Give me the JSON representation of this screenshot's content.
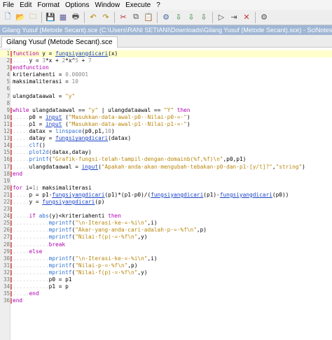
{
  "menu": [
    "File",
    "Edit",
    "Format",
    "Options",
    "Window",
    "Execute",
    "?"
  ],
  "toolbar": [
    {
      "name": "new-file-icon",
      "glyph": "🗋",
      "color": "#4a72b5"
    },
    {
      "name": "open-file-icon",
      "glyph": "📂",
      "color": "#c89b2c"
    },
    {
      "name": "open-recent-icon",
      "glyph": "🗀",
      "color": "#c89b2c"
    },
    {
      "sep": true
    },
    {
      "name": "save-icon",
      "glyph": "💾",
      "color": "#3a5fa8"
    },
    {
      "name": "save-as-icon",
      "glyph": "▦",
      "color": "#5a5a9a"
    },
    {
      "name": "print-icon",
      "glyph": "🖶",
      "color": "#555555"
    },
    {
      "sep": true
    },
    {
      "name": "undo-icon",
      "glyph": "↶",
      "color": "#b8860b"
    },
    {
      "name": "redo-icon",
      "glyph": "↷",
      "color": "#b8860b"
    },
    {
      "sep": true
    },
    {
      "name": "cut-icon",
      "glyph": "✂",
      "color": "#c03030"
    },
    {
      "name": "copy-icon",
      "glyph": "⧉",
      "color": "#505050"
    },
    {
      "name": "paste-icon",
      "glyph": "📋",
      "color": "#8a6a30"
    },
    {
      "sep": true
    },
    {
      "name": "find-replace-icon",
      "glyph": "⚙",
      "color": "#4a6aa0"
    },
    {
      "name": "load-into-scilab-icon",
      "glyph": "⇩",
      "color": "#2e8b2e"
    },
    {
      "name": "execute-file-icon",
      "glyph": "⇩",
      "color": "#2e8b2e"
    },
    {
      "name": "execute-with-echo-icon",
      "glyph": "⇩",
      "color": "#3a7a3a"
    },
    {
      "sep": true
    },
    {
      "name": "run-icon",
      "glyph": "▷",
      "color": "#505050"
    },
    {
      "name": "step-icon",
      "glyph": "⇥",
      "color": "#505050"
    },
    {
      "name": "stop-icon",
      "glyph": "✕",
      "color": "#c03030"
    },
    {
      "sep": true
    },
    {
      "name": "help-icon",
      "glyph": "⚙",
      "color": "#505050"
    }
  ],
  "window_title": "Gilang Yusuf (Metode Secant).sce (C:\\Users\\RANI SETIANI\\Downloads\\Gilang Yusuf (Metode Secant).sce) - SciNotes",
  "tab_label": "Gilang Yusuf (Metode Secant).sce",
  "code_lines": [
    [
      [
        "kw",
        "function"
      ],
      [
        "t",
        " y = "
      ],
      [
        "fn",
        "fungsiyangdicari"
      ],
      [
        "t",
        "(x)"
      ]
    ],
    [
      [
        "d",
        "....."
      ],
      [
        "t",
        "y = "
      ],
      [
        "num",
        "3"
      ],
      [
        "t",
        "*x + "
      ],
      [
        "num",
        "2"
      ],
      [
        "t",
        "*x^"
      ],
      [
        "num",
        "5"
      ],
      [
        "t",
        " + "
      ],
      [
        "num",
        "7"
      ]
    ],
    [
      [
        "kw",
        "endfunction"
      ]
    ],
    [
      [
        "t",
        "kriteriahenti = "
      ],
      [
        "num",
        "0.00001"
      ]
    ],
    [
      [
        "t",
        "maksimaliterasi = "
      ],
      [
        "num",
        "10"
      ]
    ],
    [
      [
        "t",
        ""
      ]
    ],
    [
      [
        "t",
        "ulangdataawal = "
      ],
      [
        "str",
        "\"y\""
      ]
    ],
    [
      [
        "t",
        ""
      ]
    ],
    [
      [
        "kw",
        "while"
      ],
      [
        "t",
        " ulangdataawal == "
      ],
      [
        "str",
        "\"y\""
      ],
      [
        "t",
        " | ulangdataawal == "
      ],
      [
        "str",
        "\"Y\""
      ],
      [
        "t",
        " "
      ],
      [
        "kw",
        "then"
      ]
    ],
    [
      [
        "d",
        "....."
      ],
      [
        "t",
        "p0 = "
      ],
      [
        "fn",
        "input"
      ],
      [
        "t",
        " ("
      ],
      [
        "str",
        "\"Masukkan·data·awal·p0··Nilai·p0·=·\""
      ],
      [
        "t",
        ")"
      ]
    ],
    [
      [
        "d",
        "....."
      ],
      [
        "t",
        "p1 = "
      ],
      [
        "fn",
        "input"
      ],
      [
        "t",
        " ("
      ],
      [
        "str",
        "\"Masukkan·data·awal·p1··Nilai·p1·=·\""
      ],
      [
        "t",
        ")"
      ]
    ],
    [
      [
        "d",
        "....."
      ],
      [
        "t",
        "datax = "
      ],
      [
        "bi",
        "linspace"
      ],
      [
        "t",
        "(p0,p1,"
      ],
      [
        "num",
        "10"
      ],
      [
        "t",
        ")"
      ]
    ],
    [
      [
        "d",
        "....."
      ],
      [
        "t",
        "datay = "
      ],
      [
        "fn",
        "fungsiyangdicari"
      ],
      [
        "t",
        "(datax)"
      ]
    ],
    [
      [
        "d",
        "....."
      ],
      [
        "bi",
        "clf"
      ],
      [
        "t",
        "()"
      ]
    ],
    [
      [
        "d",
        "....."
      ],
      [
        "bi",
        "plot2d"
      ],
      [
        "t",
        "(datax,datay)"
      ]
    ],
    [
      [
        "d",
        "....."
      ],
      [
        "bi",
        "printf"
      ],
      [
        "t",
        "("
      ],
      [
        "str",
        "\"Grafik·fungsi·telah·tampil·dengan·domainb(%f,%f)\\n\""
      ],
      [
        "t",
        ",p0,p1)"
      ]
    ],
    [
      [
        "d",
        "....."
      ],
      [
        "t",
        "ulangdataawal = "
      ],
      [
        "fn",
        "input"
      ],
      [
        "t",
        "("
      ],
      [
        "str",
        "\"Apakah·anda·akan·mengubah·tebakan·p0·dan·p1·[y/t]?\""
      ],
      [
        "t",
        ","
      ],
      [
        "str",
        "\"string\""
      ],
      [
        "t",
        ")"
      ]
    ],
    [
      [
        "kw",
        "end"
      ]
    ],
    [
      [
        "t",
        ""
      ]
    ],
    [
      [
        "kw",
        "for"
      ],
      [
        "t",
        " i="
      ],
      [
        "num",
        "1"
      ],
      [
        "t",
        ": maksimaliterasi"
      ]
    ],
    [
      [
        "d",
        "....."
      ],
      [
        "t",
        "p = p1-"
      ],
      [
        "fn",
        "fungsiyangdicari"
      ],
      [
        "t",
        "(p1)*(p1-p0)/("
      ],
      [
        "fn",
        "fungsiyangdicari"
      ],
      [
        "t",
        "(p1)-"
      ],
      [
        "fn",
        "fungsiyangdicari"
      ],
      [
        "t",
        "(p0))"
      ]
    ],
    [
      [
        "d",
        "....."
      ],
      [
        "t",
        "y = "
      ],
      [
        "fn",
        "fungsiyangdicari"
      ],
      [
        "t",
        "(p)"
      ]
    ],
    [
      [
        "t",
        ""
      ]
    ],
    [
      [
        "d",
        "....."
      ],
      [
        "kw",
        "if"
      ],
      [
        "t",
        " "
      ],
      [
        "bi",
        "abs"
      ],
      [
        "t",
        "(y)<kriteriahenti "
      ],
      [
        "kw",
        "then"
      ]
    ],
    [
      [
        "d",
        "..........."
      ],
      [
        "bi",
        "mprintf"
      ],
      [
        "t",
        "("
      ],
      [
        "str",
        "\"\\n·Iterasi·ke·=·%i\\n\""
      ],
      [
        "t",
        ",i)"
      ]
    ],
    [
      [
        "d",
        "..........."
      ],
      [
        "bi",
        "mprintf"
      ],
      [
        "t",
        "("
      ],
      [
        "str",
        "\"Akar·yang·anda·cari·adalah·p·=·%f\\n\""
      ],
      [
        "t",
        ",p)"
      ]
    ],
    [
      [
        "d",
        "..........."
      ],
      [
        "bi",
        "mprintf"
      ],
      [
        "t",
        "("
      ],
      [
        "str",
        "\"Nilai·f(p)·=·%f\\n\""
      ],
      [
        "t",
        ",y)"
      ]
    ],
    [
      [
        "d",
        "..........."
      ],
      [
        "kw",
        "break"
      ]
    ],
    [
      [
        "d",
        "....."
      ],
      [
        "kw",
        "else"
      ]
    ],
    [
      [
        "d",
        "..........."
      ],
      [
        "bi",
        "mprintf"
      ],
      [
        "t",
        "("
      ],
      [
        "str",
        "\"\\n·Iterasi·ke·=·%i\\n\""
      ],
      [
        "t",
        ",i)"
      ]
    ],
    [
      [
        "d",
        "..........."
      ],
      [
        "bi",
        "mprintf"
      ],
      [
        "t",
        "("
      ],
      [
        "str",
        "\"Nilai·p·=·%f\\n\""
      ],
      [
        "t",
        ",p)"
      ]
    ],
    [
      [
        "d",
        "..........."
      ],
      [
        "bi",
        "mprintf"
      ],
      [
        "t",
        "("
      ],
      [
        "str",
        "\"Nilai·f(p)·=·%f\\n\""
      ],
      [
        "t",
        ",y)"
      ]
    ],
    [
      [
        "d",
        "..........."
      ],
      [
        "t",
        "p0 = p1"
      ]
    ],
    [
      [
        "d",
        "..........."
      ],
      [
        "t",
        "p1 = p"
      ]
    ],
    [
      [
        "d",
        "....."
      ],
      [
        "kw",
        "end"
      ]
    ],
    [
      [
        "kw",
        "end"
      ]
    ]
  ],
  "current_line": 1,
  "fold_lines": [
    1,
    2,
    3,
    9,
    10,
    11,
    12,
    13,
    14,
    15,
    16,
    17,
    18,
    20,
    21,
    22,
    23,
    24,
    25,
    26,
    27,
    28,
    29,
    30,
    31,
    32,
    33,
    34,
    35,
    36
  ]
}
